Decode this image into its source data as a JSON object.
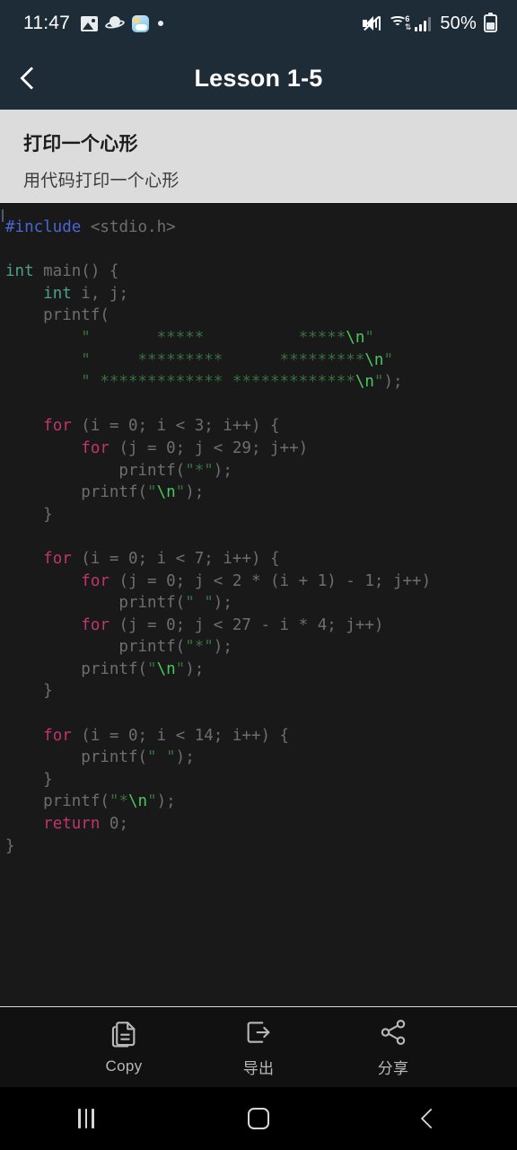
{
  "status_bar": {
    "time": "11:47",
    "battery_percent": "50%",
    "left_icons": [
      "gallery-icon",
      "saturn-icon",
      "weather-icon",
      "dot-indicator-icon"
    ],
    "right_icons": [
      "mute-icon",
      "wifi-6-icon",
      "cell-signal-icon",
      "battery-icon"
    ],
    "background": "#1e2c38"
  },
  "app_bar": {
    "title": "Lesson 1-5",
    "back_icon": "chevron-left-icon",
    "background": "#1e2c38"
  },
  "lesson_header": {
    "title": "打印一个心形",
    "subtitle": "用代码打印一个心形",
    "background": "#dcdcdc"
  },
  "editor": {
    "background": "#191919",
    "language": "c",
    "colors": {
      "preprocessor": "#4a66d6",
      "type": "#4e9e8e",
      "keyword": "#c0356e",
      "string": "#37703f",
      "escape": "#49c85e",
      "plain": "#6e6e6e"
    },
    "lines": [
      [
        {
          "t": "#include",
          "c": "k-pre"
        },
        {
          "t": " <stdio.h>",
          "c": "k-plain"
        }
      ],
      [],
      [
        {
          "t": "int",
          "c": "k-type"
        },
        {
          "t": " main() {",
          "c": "k-plain"
        }
      ],
      [
        {
          "t": "    ",
          "c": "k-plain"
        },
        {
          "t": "int",
          "c": "k-type"
        },
        {
          "t": " i, j;",
          "c": "k-plain"
        }
      ],
      [
        {
          "t": "    printf(",
          "c": "k-plain"
        }
      ],
      [
        {
          "t": "        \"       *****          *****",
          "c": "k-str"
        },
        {
          "t": "\\n",
          "c": "k-esc"
        },
        {
          "t": "\"",
          "c": "k-str"
        }
      ],
      [
        {
          "t": "        \"     *********      *********",
          "c": "k-str"
        },
        {
          "t": "\\n",
          "c": "k-esc"
        },
        {
          "t": "\"",
          "c": "k-str"
        }
      ],
      [
        {
          "t": "        \" ************* *************",
          "c": "k-str"
        },
        {
          "t": "\\n",
          "c": "k-esc"
        },
        {
          "t": "\"",
          "c": "k-str"
        },
        {
          "t": ");",
          "c": "k-plain"
        }
      ],
      [],
      [
        {
          "t": "    ",
          "c": "k-plain"
        },
        {
          "t": "for",
          "c": "k-for"
        },
        {
          "t": " (i = 0; i < 3; i++) {",
          "c": "k-plain"
        }
      ],
      [
        {
          "t": "        ",
          "c": "k-plain"
        },
        {
          "t": "for",
          "c": "k-for"
        },
        {
          "t": " (j = 0; j < 29; j++)",
          "c": "k-plain"
        }
      ],
      [
        {
          "t": "            printf(",
          "c": "k-plain"
        },
        {
          "t": "\"*\"",
          "c": "k-str"
        },
        {
          "t": ");",
          "c": "k-plain"
        }
      ],
      [
        {
          "t": "        printf(",
          "c": "k-plain"
        },
        {
          "t": "\"",
          "c": "k-str"
        },
        {
          "t": "\\n",
          "c": "k-esc"
        },
        {
          "t": "\"",
          "c": "k-str"
        },
        {
          "t": ");",
          "c": "k-plain"
        }
      ],
      [
        {
          "t": "    }",
          "c": "k-plain"
        }
      ],
      [],
      [
        {
          "t": "    ",
          "c": "k-plain"
        },
        {
          "t": "for",
          "c": "k-for"
        },
        {
          "t": " (i = 0; i < 7; i++) {",
          "c": "k-plain"
        }
      ],
      [
        {
          "t": "        ",
          "c": "k-plain"
        },
        {
          "t": "for",
          "c": "k-for"
        },
        {
          "t": " (j = 0; j < 2 * (i + 1) - 1; j++)",
          "c": "k-plain"
        }
      ],
      [
        {
          "t": "            printf(",
          "c": "k-plain"
        },
        {
          "t": "\" \"",
          "c": "k-str"
        },
        {
          "t": ");",
          "c": "k-plain"
        }
      ],
      [
        {
          "t": "        ",
          "c": "k-plain"
        },
        {
          "t": "for",
          "c": "k-for"
        },
        {
          "t": " (j = 0; j < 27 - i * 4; j++)",
          "c": "k-plain"
        }
      ],
      [
        {
          "t": "            printf(",
          "c": "k-plain"
        },
        {
          "t": "\"*\"",
          "c": "k-str"
        },
        {
          "t": ");",
          "c": "k-plain"
        }
      ],
      [
        {
          "t": "        printf(",
          "c": "k-plain"
        },
        {
          "t": "\"",
          "c": "k-str"
        },
        {
          "t": "\\n",
          "c": "k-esc"
        },
        {
          "t": "\"",
          "c": "k-str"
        },
        {
          "t": ");",
          "c": "k-plain"
        }
      ],
      [
        {
          "t": "    }",
          "c": "k-plain"
        }
      ],
      [],
      [
        {
          "t": "    ",
          "c": "k-plain"
        },
        {
          "t": "for",
          "c": "k-for"
        },
        {
          "t": " (i = 0; i < 14; i++) {",
          "c": "k-plain"
        }
      ],
      [
        {
          "t": "        printf(",
          "c": "k-plain"
        },
        {
          "t": "\" \"",
          "c": "k-str"
        },
        {
          "t": ");",
          "c": "k-plain"
        }
      ],
      [
        {
          "t": "    }",
          "c": "k-plain"
        }
      ],
      [
        {
          "t": "    printf(",
          "c": "k-plain"
        },
        {
          "t": "\"*",
          "c": "k-str"
        },
        {
          "t": "\\n",
          "c": "k-esc"
        },
        {
          "t": "\"",
          "c": "k-str"
        },
        {
          "t": ");",
          "c": "k-plain"
        }
      ],
      [
        {
          "t": "    ",
          "c": "k-plain"
        },
        {
          "t": "return",
          "c": "k-for"
        },
        {
          "t": " 0;",
          "c": "k-plain"
        }
      ],
      [
        {
          "t": "}",
          "c": "k-plain"
        }
      ]
    ]
  },
  "toolbar": {
    "buttons": [
      {
        "label": "Copy",
        "icon": "copy-icon"
      },
      {
        "label": "导出",
        "icon": "export-icon"
      },
      {
        "label": "分享",
        "icon": "share-icon"
      }
    ]
  },
  "nav_bar": {
    "recents_icon": "recents-icon",
    "home_icon": "home-icon",
    "back_icon": "back-icon"
  }
}
